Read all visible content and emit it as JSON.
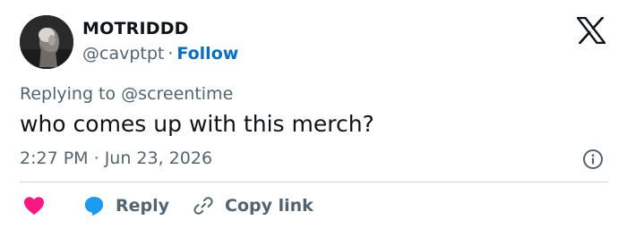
{
  "author": {
    "display_name": "MOTRIDDD",
    "handle": "@cavptpt",
    "separator": "·",
    "follow_label": "Follow"
  },
  "reply_context": {
    "prefix": "Replying to",
    "target": "@screentime"
  },
  "tweet": {
    "text": "who comes up with this merch?",
    "time": "2:27 PM",
    "separator": "·",
    "date": "Jun 23, 2026"
  },
  "actions": {
    "like_icon": "heart-icon",
    "reply_label": "Reply",
    "reply_icon": "speech-bubble-icon",
    "copy_label": "Copy link",
    "copy_icon": "link-icon"
  },
  "colors": {
    "like": "#f91880",
    "reply": "#1d9bf0",
    "follow": "#0a6fc2",
    "muted": "#536471",
    "text": "#0f1419"
  }
}
